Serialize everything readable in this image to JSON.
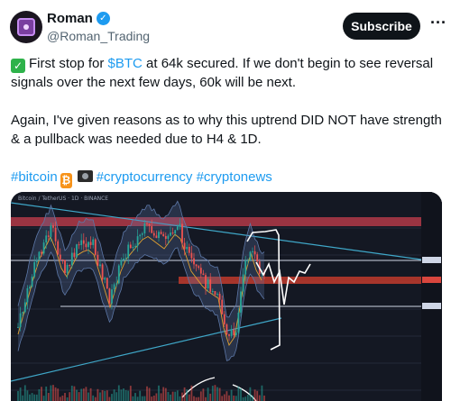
{
  "author": {
    "display_name": "Roman",
    "handle": "@Roman_Trading",
    "verified_icon": "verified-badge-icon",
    "avatar_icon": "avatar-icon"
  },
  "actions": {
    "subscribe_label": "Subscribe",
    "more_icon": "more-icon",
    "more_glyph": "···"
  },
  "tweet": {
    "p1_prefix": "First stop for ",
    "p1_link": "$BTC",
    "p1_rest": " at 64k secured. If we don't begin to see reversal signals over the next few days, 60k will be next.",
    "p2": "Again, I've given reasons as to why this uptrend DID NOT have strength & a pullback was needed due to H4 & 1D.",
    "hashtag1": "#bitcoin",
    "hashtag2": "#cryptocurrency",
    "hashtag3": "#cryptonews",
    "check_icon": "check-mark-icon",
    "bitcoin_emoji_icon": "bitcoin-emoji-icon",
    "camera_emoji_icon": "camera-emoji-icon",
    "check_glyph": "✓",
    "btc_glyph": "₿"
  },
  "chart": {
    "title_text": "Bitcoin / TetherUS · 1D · BINANCE",
    "colors": {
      "background": "#141823",
      "up_candle": "#26a69a",
      "down_candle": "#ef5350",
      "resistance_zone": "#b23a48",
      "support_zone": "#c0392b",
      "trendline": "#3fa7c8",
      "bands": "#5d78a8",
      "drawing": "#ffffff"
    }
  }
}
